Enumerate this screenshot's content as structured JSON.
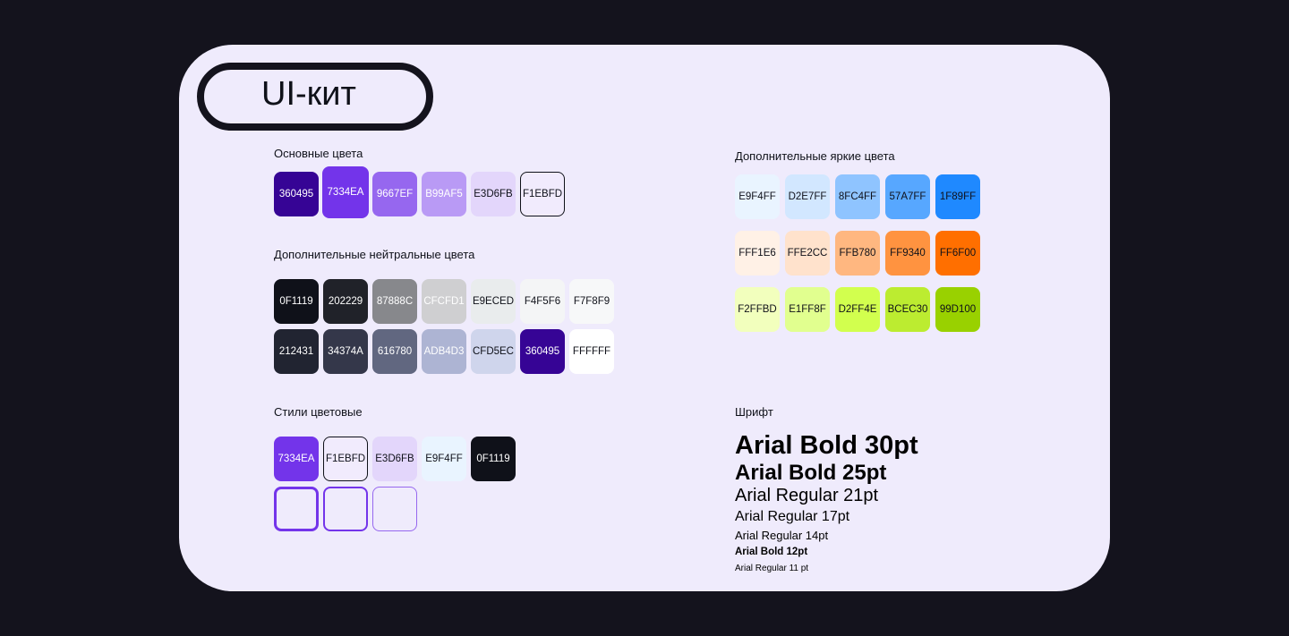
{
  "title": "UI-кит",
  "primary": {
    "label": "Основные цвета",
    "swatches": [
      {
        "hex": "360495",
        "color": "#360495",
        "text_color": "#ffffff"
      },
      {
        "hex": "7334EA",
        "color": "#7334ea",
        "text_color": "#ffffff"
      },
      {
        "hex": "9667EF",
        "color": "#9667ef",
        "text_color": "#ffffff"
      },
      {
        "hex": "B99AF5",
        "color": "#b99af5",
        "text_color": "#ffffff"
      },
      {
        "hex": "E3D6FB",
        "color": "#e3d6fb",
        "text_color": "#0f1119"
      },
      {
        "hex": "F1EBFD",
        "color": "#f1ebfd",
        "text_color": "#0f1119",
        "border": "#0f1119"
      }
    ]
  },
  "neutral": {
    "label": "Дополнительные нейтральные цвета",
    "row1": [
      {
        "hex": "0F1119",
        "color": "#0f1119",
        "text_color": "#ffffff"
      },
      {
        "hex": "202229",
        "color": "#202229",
        "text_color": "#ffffff"
      },
      {
        "hex": "87888C",
        "color": "#87888c",
        "text_color": "#ffffff"
      },
      {
        "hex": "CFCFD1",
        "color": "#cfcfd1",
        "text_color": "#ffffff"
      },
      {
        "hex": "E9ECED",
        "color": "#e9eced",
        "text_color": "#0f1119"
      },
      {
        "hex": "F4F5F6",
        "color": "#f4f5f6",
        "text_color": "#0f1119"
      },
      {
        "hex": "F7F8F9",
        "color": "#f7f8f9",
        "text_color": "#0f1119"
      }
    ],
    "row2": [
      {
        "hex": "212431",
        "color": "#212431",
        "text_color": "#ffffff"
      },
      {
        "hex": "34374A",
        "color": "#34374a",
        "text_color": "#ffffff"
      },
      {
        "hex": "616780",
        "color": "#616780",
        "text_color": "#ffffff"
      },
      {
        "hex": "ADB4D3",
        "color": "#adb4d3",
        "text_color": "#ffffff"
      },
      {
        "hex": "CFD5EC",
        "color": "#cfd5ec",
        "text_color": "#0f1119"
      },
      {
        "hex": "360495",
        "color": "#360495",
        "text_color": "#ffffff"
      },
      {
        "hex": "FFFFFF",
        "color": "#ffffff",
        "text_color": "#0f1119"
      }
    ]
  },
  "styles": {
    "label": "Стили цветовые",
    "swatches": [
      {
        "hex": "7334EA",
        "color": "#7334ea",
        "text_color": "#ffffff"
      },
      {
        "hex": "F1EBFD",
        "color": "#f1ebfd",
        "text_color": "#0f1119",
        "border": "#0f1119"
      },
      {
        "hex": "E3D6FB",
        "color": "#e3d6fb",
        "text_color": "#0f1119"
      },
      {
        "hex": "E9F4FF",
        "color": "#e9f4ff",
        "text_color": "#0f1119"
      },
      {
        "hex": "0F1119",
        "color": "#0f1119",
        "text_color": "#ffffff"
      }
    ],
    "outlines": [
      {
        "border": "#7334ea",
        "weight": "thick"
      },
      {
        "border": "#7334ea",
        "weight": "medium"
      },
      {
        "border": "#9667ef",
        "weight": "thin"
      }
    ]
  },
  "bright": {
    "label": "Дополнительные яркие цвета",
    "rows": [
      [
        {
          "hex": "E9F4FF",
          "color": "#e9f4ff",
          "text_color": "#0f1119"
        },
        {
          "hex": "D2E7FF",
          "color": "#d2e7ff",
          "text_color": "#0f1119"
        },
        {
          "hex": "8FC4FF",
          "color": "#8fc4ff",
          "text_color": "#0f1119"
        },
        {
          "hex": "57A7FF",
          "color": "#57a7ff",
          "text_color": "#0f1119"
        },
        {
          "hex": "1F89FF",
          "color": "#1f89ff",
          "text_color": "#0f1119"
        }
      ],
      [
        {
          "hex": "FFF1E6",
          "color": "#fff1e6",
          "text_color": "#0f1119"
        },
        {
          "hex": "FFE2CC",
          "color": "#ffe2cc",
          "text_color": "#0f1119"
        },
        {
          "hex": "FFB780",
          "color": "#ffb780",
          "text_color": "#0f1119"
        },
        {
          "hex": "FF9340",
          "color": "#ff9340",
          "text_color": "#0f1119"
        },
        {
          "hex": "FF6F00",
          "color": "#ff6f00",
          "text_color": "#0f1119"
        }
      ],
      [
        {
          "hex": "F2FFBD",
          "color": "#f2ffbd",
          "text_color": "#0f1119"
        },
        {
          "hex": "E1FF8F",
          "color": "#e1ff8f",
          "text_color": "#0f1119"
        },
        {
          "hex": "D2FF4E",
          "color": "#d2ff4e",
          "text_color": "#0f1119"
        },
        {
          "hex": "BCEC30",
          "color": "#bcec30",
          "text_color": "#0f1119"
        },
        {
          "hex": "99D100",
          "color": "#99d100",
          "text_color": "#0f1119"
        }
      ]
    ]
  },
  "fonts": {
    "label": "Шрифт",
    "samples": [
      {
        "text": "Arial Bold 30pt",
        "weight": "bold"
      },
      {
        "text": "Arial Bold 25pt",
        "weight": "bold"
      },
      {
        "text": "Arial Regular 21pt",
        "weight": "normal"
      },
      {
        "text": "Arial Regular 17pt",
        "weight": "normal"
      },
      {
        "text": "Arial Regular 14pt",
        "weight": "normal"
      },
      {
        "text": "Arial Bold 12pt",
        "weight": "bold"
      },
      {
        "text": "Arial Regular 11 pt",
        "weight": "normal"
      }
    ]
  }
}
